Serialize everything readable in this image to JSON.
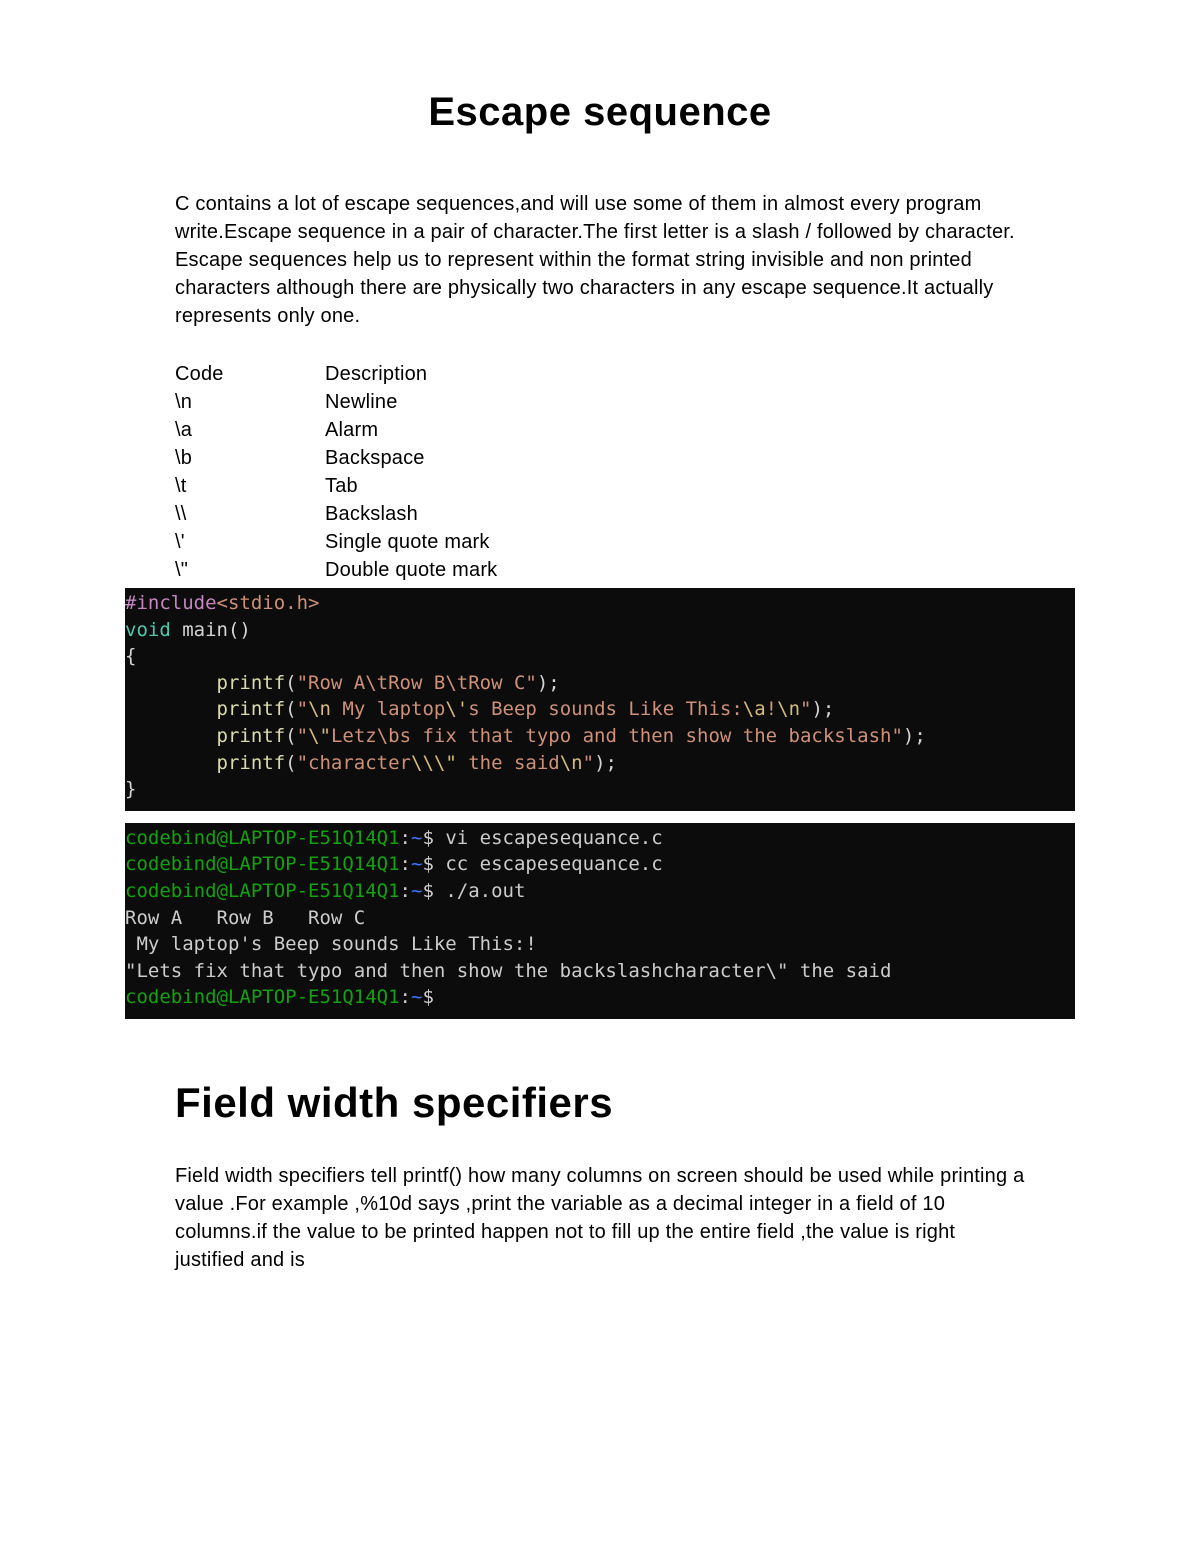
{
  "title": "Escape sequence",
  "intro": "C contains a lot of escape sequences,and will use some of them in almost every program write.Escape sequence in a pair of character.The first letter is a slash / followed by character. Escape sequences help us to represent within the format string invisible and non printed characters although there are physically two characters in any escape sequence.It actually represents  only one.",
  "table": {
    "head": {
      "code": "Code",
      "desc": "Description"
    },
    "rows": [
      {
        "code": "\\n",
        "desc": "Newline"
      },
      {
        "code": "\\a",
        "desc": "Alarm"
      },
      {
        "code": "\\b",
        "desc": "Backspace"
      },
      {
        "code": "\\t",
        "desc": "Tab"
      },
      {
        "code": "\\\\",
        "desc": "Backslash"
      },
      {
        "code": "\\'",
        "desc": "Single quote mark"
      },
      {
        "code": "\\\"",
        "desc": "Double quote mark"
      }
    ]
  },
  "code": {
    "include_kw": "#include",
    "include_hdr": "<stdio.h>",
    "void_kw": "void",
    "main_sig": " main()",
    "brace_open": "{",
    "brace_close": "}",
    "printf": "printf",
    "l1_str": "\"Row A\\tRow B\\tRow C\"",
    "l2_pre": "\"",
    "l2_esc1": "\\n",
    "l2_mid1": " My laptop",
    "l2_esc2": "\\'",
    "l2_mid2": "s Beep sounds Like This:",
    "l2_esc3": "\\a",
    "l2_mid3": "!",
    "l2_esc4": "\\n",
    "l2_post": "\"",
    "l3_pre": "\"",
    "l3_esc1": "\\\"",
    "l3_mid1": "Letz\\bs fix that typo and then show the backslash",
    "l3_post": "\"",
    "l4_pre": "\"character",
    "l4_esc1": "\\\\\\\"",
    "l4_mid1": " the said",
    "l4_esc2": "\\n",
    "l4_post": "\""
  },
  "terminal": {
    "prompt_user_host": "codebind@LAPTOP-E51Q14Q1",
    "prompt_colon": ":",
    "prompt_path": "~",
    "prompt_dollar": "$ ",
    "cmd1": "vi escapesequance.c",
    "cmd2": "cc escapesequance.c",
    "cmd3": "./a.out",
    "out1": "Row A   Row B   Row C",
    "out2": " My laptop's Beep sounds Like This:!",
    "out3": "\"Lets fix that typo and then show the backslashcharacter\\\" the said"
  },
  "subtitle": "Field width specifiers",
  "body2": "Field width specifiers tell printf() how many columns on screen should be used while printing a value .For example ,%10d says ,print the variable as a decimal integer in a field of 10 columns.if the value to be printed happen not to fill up the entire field ,the value is right justified and  is"
}
